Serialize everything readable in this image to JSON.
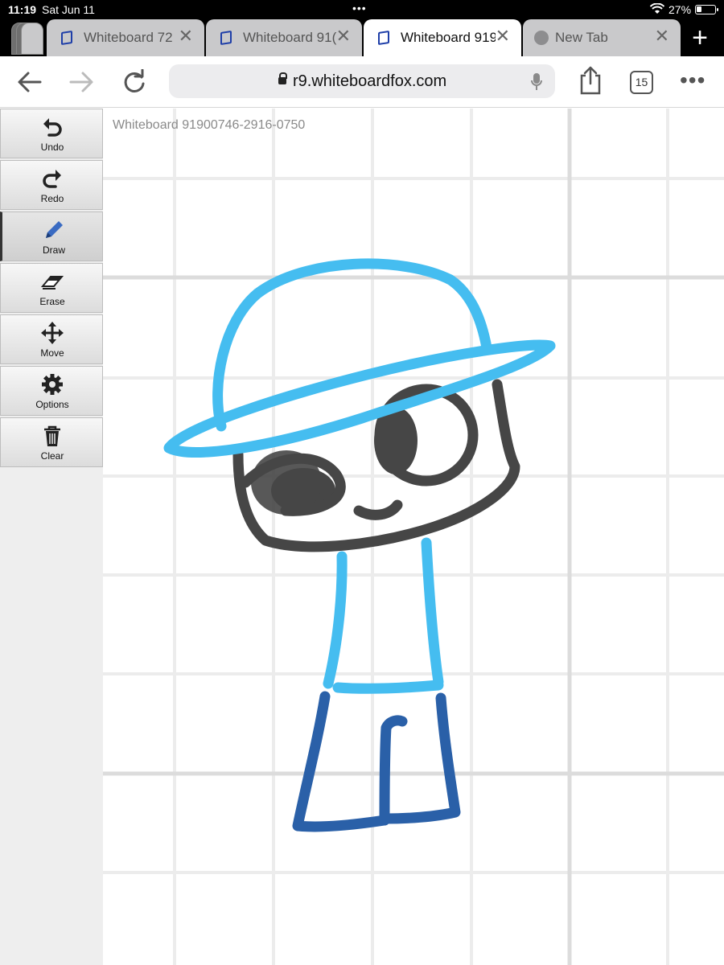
{
  "status_bar": {
    "time": "11:19",
    "date": "Sat Jun 11",
    "battery": "27%"
  },
  "tabs": [
    {
      "title": "Whiteboard 72",
      "active": false
    },
    {
      "title": "Whiteboard 91(",
      "active": false
    },
    {
      "title": "Whiteboard 919",
      "active": true
    },
    {
      "title": "New Tab",
      "active": false
    }
  ],
  "toolbar": {
    "url": "r9.whiteboardfox.com",
    "tab_count": "15"
  },
  "sidebar": {
    "tools": [
      {
        "label": "Undo",
        "icon": "undo-icon"
      },
      {
        "label": "Redo",
        "icon": "redo-icon"
      },
      {
        "label": "Draw",
        "icon": "pencil-icon"
      },
      {
        "label": "Erase",
        "icon": "eraser-icon"
      },
      {
        "label": "Move",
        "icon": "move-icon"
      },
      {
        "label": "Options",
        "icon": "gear-icon"
      },
      {
        "label": "Clear",
        "icon": "trash-icon"
      }
    ],
    "active_tool": "Draw"
  },
  "board": {
    "title": "Whiteboard 91900746-2916-0750"
  },
  "colors": {
    "hat": "#45bdf0",
    "face": "#464646",
    "body": "#45bdf0",
    "legs": "#2a60a8",
    "grid": "#e4e4e4"
  }
}
